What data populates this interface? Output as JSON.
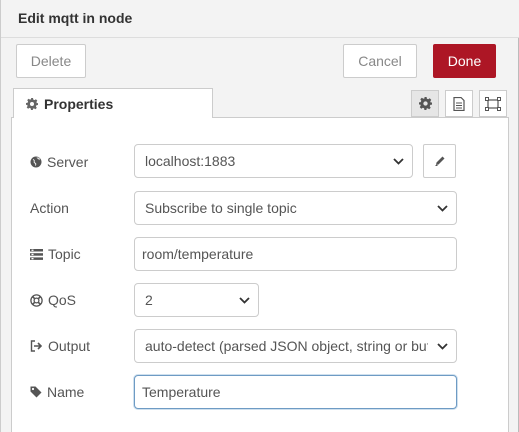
{
  "header": {
    "title": "Edit mqtt in node"
  },
  "toolbar": {
    "delete_label": "Delete",
    "cancel_label": "Cancel",
    "done_label": "Done"
  },
  "tabs": {
    "properties_label": "Properties",
    "icon_tabs": [
      "gear-icon",
      "document-icon",
      "frame-icon"
    ]
  },
  "form": {
    "server": {
      "label": "Server",
      "value": "localhost:1883"
    },
    "action": {
      "label": "Action",
      "value": "Subscribe to single topic"
    },
    "topic": {
      "label": "Topic",
      "value": "room/temperature"
    },
    "qos": {
      "label": "QoS",
      "value": "2"
    },
    "output": {
      "label": "Output",
      "value": "auto-detect (parsed JSON object, string or buf"
    },
    "name": {
      "label": "Name",
      "value": "Temperature"
    }
  },
  "colors": {
    "accent": "#ad1625",
    "focus_border": "#6e9bc4"
  }
}
